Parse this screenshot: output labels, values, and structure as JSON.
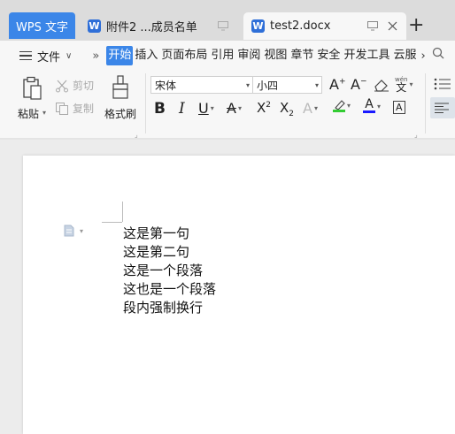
{
  "tabs": {
    "home_label": "WPS 文字",
    "doc1_label": "附件2 ...成员名单",
    "doc2_label": "test2.docx",
    "new_tab": "+"
  },
  "menu": {
    "file_label": "文件",
    "items": [
      "开始",
      "插入",
      "页面布局",
      "引用",
      "审阅",
      "视图",
      "章节",
      "安全",
      "开发工具",
      "云服"
    ],
    "active_item": "开始"
  },
  "ribbon": {
    "paste_label": "粘贴",
    "cut_label": "剪切",
    "copy_label": "复制",
    "format_painter_label": "格式刷",
    "font_name": "宋体",
    "font_size": "小四",
    "pinyin_label": "wén"
  },
  "document": {
    "lines": [
      "这是第一句",
      "这是第二句",
      "这是一个段落",
      "这也是一个段落",
      "段内强制换行"
    ]
  },
  "colors": {
    "accent": "#3b86e8",
    "highlight_color": "#33cc33",
    "font_color": "#1a1aff"
  }
}
